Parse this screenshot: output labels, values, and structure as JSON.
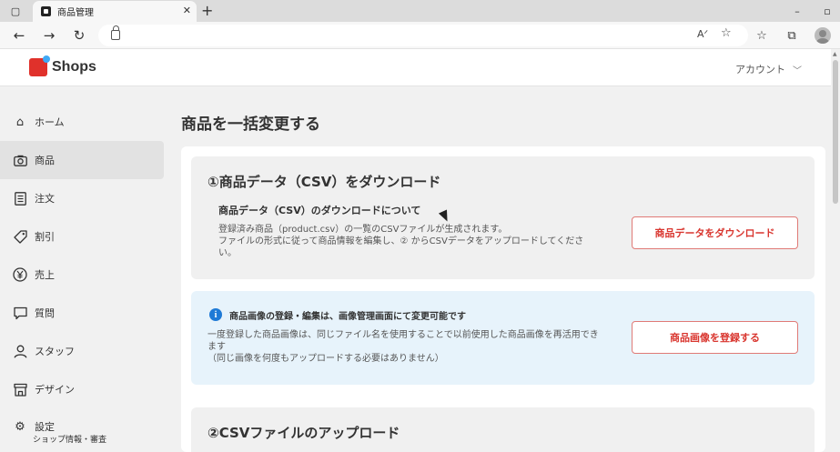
{
  "browser": {
    "tab_title": "商品管理",
    "tab_close": "✕",
    "new_tab": "+",
    "read_aloud": "A͡"
  },
  "header": {
    "logo_text": "Shops",
    "account_label": "アカウント"
  },
  "sidebar": {
    "items": [
      {
        "label": "ホーム",
        "icon": "home-icon"
      },
      {
        "label": "商品",
        "icon": "camera-icon"
      },
      {
        "label": "注文",
        "icon": "list-icon"
      },
      {
        "label": "割引",
        "icon": "tag-icon"
      },
      {
        "label": "売上",
        "icon": "yen-icon"
      },
      {
        "label": "質問",
        "icon": "chat-icon"
      },
      {
        "label": "スタッフ",
        "icon": "person-icon"
      },
      {
        "label": "デザイン",
        "icon": "store-icon"
      },
      {
        "label": "設定",
        "icon": "gear-icon",
        "sub": "ショップ情報・審査"
      }
    ],
    "active_index": 1
  },
  "main": {
    "page_title": "商品を一括変更する",
    "download": {
      "title": "①商品データ（CSV）をダウンロード",
      "subtitle": "商品データ（CSV）のダウンロードについて",
      "desc_line1": "登録済み商品（product.csv）の一覧のCSVファイルが生成されます。",
      "desc_line2": "ファイルの形式に従って商品情報を編集し、② からCSVデータをアップロードしてくださ",
      "desc_line3": "い。",
      "button": "商品データをダウンロード"
    },
    "images": {
      "title": "商品画像の登録・編集は、画像管理画面にて変更可能です",
      "desc_line1": "一度登録した商品画像は、同じファイル名を使用することで以前使用した商品画像を再活用でき",
      "desc_line2": "ます",
      "desc_line3": "（同じ画像を何度もアップロードする必要はありません）",
      "button": "商品画像を登録する"
    },
    "upload": {
      "title": "②CSVファイルのアップロード"
    }
  },
  "colors": {
    "brand_red": "#e0312b",
    "button_text": "#d9362f",
    "info_blue": "#1e7ad6",
    "info_bg": "#e7f3fb"
  }
}
